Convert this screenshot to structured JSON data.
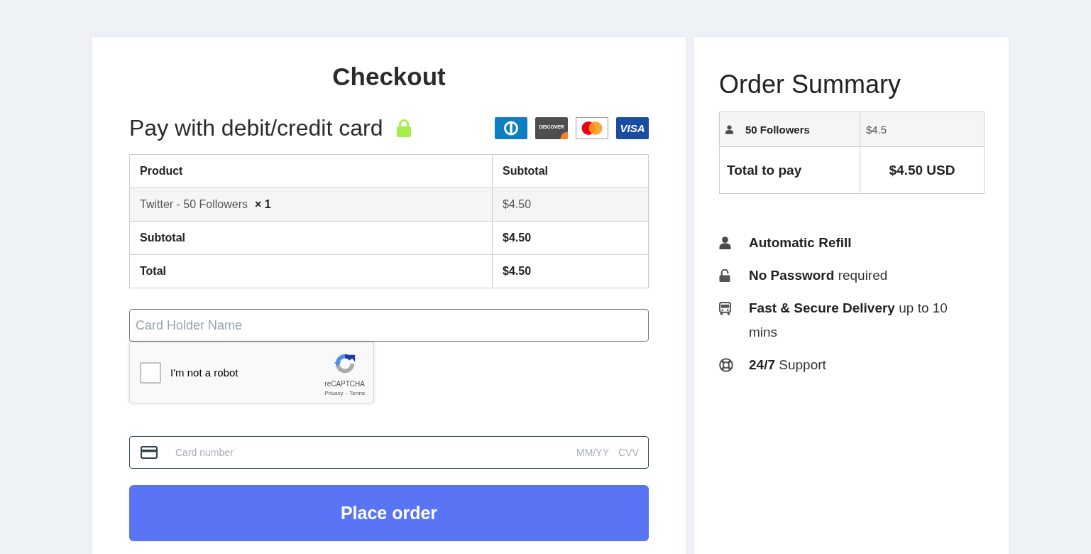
{
  "checkout": {
    "title": "Checkout",
    "pay_heading": "Pay with debit/credit card",
    "card_logos": [
      {
        "kind": "diners"
      },
      {
        "kind": "discover",
        "text": "DISCOVER"
      },
      {
        "kind": "mastercard"
      },
      {
        "kind": "visa",
        "text": "VISA"
      }
    ],
    "table": {
      "columns": [
        "Product",
        "Subtotal"
      ],
      "rows": [
        {
          "kind": "item",
          "product": "Twitter - 50 Followers",
          "quantity": "× 1",
          "amount": "$4.50"
        },
        {
          "kind": "total",
          "product": "Subtotal",
          "amount": "$4.50"
        },
        {
          "kind": "total",
          "product": "Total",
          "amount": "$4.50"
        }
      ]
    },
    "card_holder": {
      "placeholder": "Card Holder Name"
    },
    "captcha": {
      "label": "I'm not a robot",
      "checked": false,
      "brand": "reCAPTCHA",
      "links": [
        "Privacy",
        "Terms"
      ],
      "separator": "-"
    },
    "card_field": {
      "number_placeholder": "Card number",
      "expiry_placeholder": "MM/YY",
      "cvv_placeholder": "CVV"
    },
    "submit": "Place order"
  },
  "summary": {
    "title": "Order Summary",
    "rows": [
      {
        "product": "50 Followers",
        "price": "$4.5"
      }
    ],
    "total": {
      "label": "Total to pay",
      "value": "$4.50 USD"
    },
    "features": [
      {
        "kind": "user",
        "strong": "Automatic Refill"
      },
      {
        "kind": "unlock",
        "strong": "No Password",
        "text": "required"
      },
      {
        "kind": "bus",
        "strong": "Fast & Secure Delivery",
        "text": "up to 10 mins"
      },
      {
        "kind": "lifebuoy",
        "strong": "24/7",
        "text": "Support"
      }
    ]
  }
}
